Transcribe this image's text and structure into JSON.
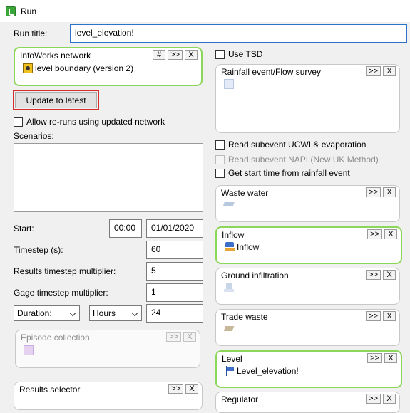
{
  "window": {
    "title": "Run"
  },
  "run_title": {
    "label": "Run title:",
    "value": "level_elevation!"
  },
  "network_panel": {
    "title": "InfoWorks network",
    "buttons": [
      "#",
      ">>",
      "X"
    ],
    "item": "level boundary (version 2)"
  },
  "update_button": "Update to latest",
  "allow_reruns": "Allow re-runs using updated network",
  "scenarios_label": "Scenarios:",
  "start": {
    "label": "Start:",
    "time": "00:00",
    "date": "01/01/2020"
  },
  "timestep": {
    "label": "Timestep (s):",
    "value": "60"
  },
  "results_multiplier": {
    "label": "Results timestep multiplier:",
    "value": "5"
  },
  "gage_multiplier": {
    "label": "Gage timestep multiplier:",
    "value": "1"
  },
  "duration": {
    "mode": "Duration:",
    "unit": "Hours",
    "value": "24"
  },
  "episode_panel": {
    "title": "Episode collection",
    "buttons": [
      ">>",
      "X"
    ]
  },
  "results_panel": {
    "title": "Results selector",
    "buttons": [
      ">>",
      "X"
    ]
  },
  "use_tsd": "Use TSD",
  "rainfall_panel": {
    "title": "Rainfall event/Flow survey",
    "buttons": [
      ">>",
      "X"
    ]
  },
  "read_ucwi": "Read subevent UCWI & evaporation",
  "read_napi": "Read subevent NAPI (New UK Method)",
  "get_start_time": "Get start time from rainfall event",
  "waste_panel": {
    "title": "Waste water",
    "buttons": [
      ">>",
      "X"
    ]
  },
  "inflow_panel": {
    "title": "Inflow",
    "buttons": [
      ">>",
      "X"
    ],
    "item": "Inflow"
  },
  "infiltration_panel": {
    "title": "Ground infiltration",
    "buttons": [
      ">>",
      "X"
    ]
  },
  "trade_panel": {
    "title": "Trade waste",
    "buttons": [
      ">>",
      "X"
    ]
  },
  "level_panel": {
    "title": "Level",
    "buttons": [
      ">>",
      "X"
    ],
    "item": "Level_elevation!"
  },
  "regulator_panel": {
    "title": "Regulator",
    "buttons": [
      ">>",
      "X"
    ]
  }
}
